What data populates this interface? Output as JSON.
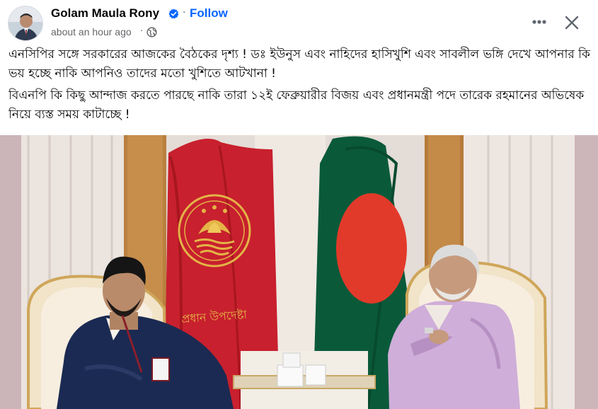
{
  "post": {
    "author": "Golam Maula Rony",
    "follow_label": "Follow",
    "timestamp": "about an hour ago",
    "separator": "·",
    "text_paragraph_1": "এনসিপির সঙ্গে সরকারের আজকের বৈঠকের দৃশ্য ! ডঃ ইউনুস এবং নাহিদের হাসিখুশি এবং সাবলীল ভঙ্গি দেখে আপনার কি ভয় হচ্ছে নাকি আপনিও তাদের মতো খুশিতে আটখানা !",
    "text_paragraph_2": "বিএনপি কি কিছু আন্দাজ করতে পারছে নাকি তারা ১২ই ফেব্রুয়ারীর বিজয় এবং প্রধানমন্ত্রী পদে তারেক রহমানের অভিষেক নিয়ে ব্যস্ত সময় কাটাচ্ছে !"
  },
  "photo": {
    "flag_text": "প্রধান উপদেষ্টা"
  },
  "icons": {
    "verified": "verified-badge-icon",
    "privacy": "globe-icon",
    "more": "more-options-icon",
    "close": "close-icon"
  },
  "colors": {
    "link_blue": "#0866ff",
    "verified_blue": "#0866ff",
    "secondary_text": "#65676b",
    "flag_red": "#c8202e",
    "flag_green": "#0a5a3a"
  }
}
